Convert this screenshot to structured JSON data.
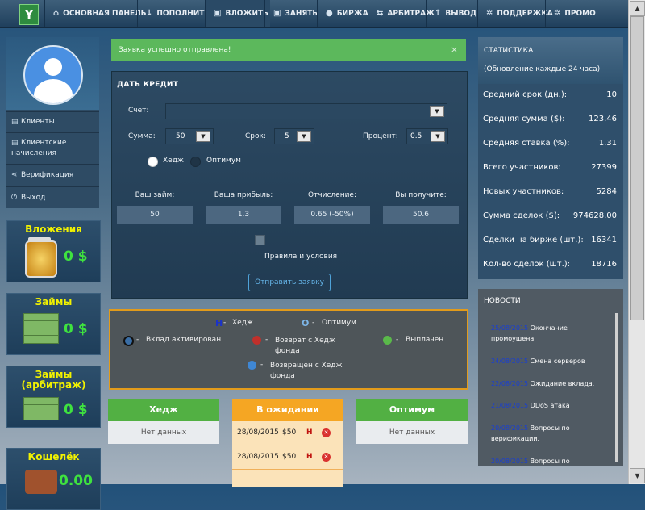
{
  "logo": "Y",
  "nav": [
    {
      "icon": "home-icon",
      "glyph": "⌂",
      "label": "ОСНОВНАЯ ПАНЕЛЬ"
    },
    {
      "icon": "download-icon",
      "glyph": "↓",
      "label": "ПОПОЛНИТЬ"
    },
    {
      "icon": "money-icon",
      "glyph": "▣",
      "label": "ВЛОЖИТЬ"
    },
    {
      "icon": "money-icon",
      "glyph": "▣",
      "label": "ЗАНЯТЬ"
    },
    {
      "icon": "globe-icon",
      "glyph": "●",
      "label": "БИРЖА"
    },
    {
      "icon": "exchange-icon",
      "glyph": "⇆",
      "label": "АРБИТРАЖ"
    },
    {
      "icon": "upload-icon",
      "glyph": "↑",
      "label": "ВЫВОД"
    },
    {
      "icon": "gears-icon",
      "glyph": "✲",
      "label": "ПОДДЕРЖКА"
    },
    {
      "icon": "gears-icon",
      "glyph": "✲",
      "label": "ПРОМО"
    }
  ],
  "user_menu": [
    {
      "icon": "chart-icon",
      "glyph": "▤",
      "label": "Клиенты"
    },
    {
      "icon": "chart-icon",
      "glyph": "▤",
      "label": "Клиентские начисления"
    },
    {
      "icon": "share-icon",
      "glyph": "⋖",
      "label": "Верификация"
    },
    {
      "icon": "power-icon",
      "glyph": "⏻",
      "label": "Выход"
    }
  ],
  "widgets": [
    {
      "title": "Вложения",
      "value": "0 $"
    },
    {
      "title": "Займы",
      "value": "0 $"
    },
    {
      "title": "Займы (арбитраж)",
      "value": "0 $"
    },
    {
      "title": "Кошелёк",
      "value": "0.00"
    }
  ],
  "alert": {
    "text": "Заявка успешно отправлена!",
    "close": "×"
  },
  "credit": {
    "title": "ДАТЬ КРЕДИТ",
    "account_label": "Счёт:",
    "account_value": "",
    "sum_label": "Сумма:",
    "sum_value": "50",
    "term_label": "Срок:",
    "term_value": "5",
    "percent_label": "Процент:",
    "percent_value": "0.5",
    "radio_hedge": "Хедж",
    "radio_optimum": "Оптимум",
    "your_loan_label": "Ваш займ:",
    "your_loan_value": "50",
    "profit_label": "Ваша прибыль:",
    "profit_value": "1.3",
    "deduction_label": "Отчисление:",
    "deduction_value": "0.65 (-50%)",
    "receive_label": "Вы получите:",
    "receive_value": "50.6",
    "terms_label": "Правила и условия",
    "submit_label": "Отправить заявку"
  },
  "legend": {
    "hedge_glyph": "H",
    "hedge": "Хедж",
    "optimum_glyph": "O",
    "optimum": "Оптимум",
    "active": "Вклад активирован",
    "returned_to": "Возврат с Хедж фонда",
    "paid": "Выплачен",
    "returned_from": "Возвращён с Хедж фонда",
    "dash": "-"
  },
  "columns": {
    "hedge": {
      "title": "Хедж",
      "body": "Нет данных"
    },
    "pending": {
      "title": "В ожидании",
      "rows": [
        {
          "date": "28/08/2015",
          "amount": "$50",
          "type": "H"
        },
        {
          "date": "28/08/2015",
          "amount": "$50",
          "type": "H"
        }
      ]
    },
    "optimum": {
      "title": "Оптимум",
      "body": "Нет данных"
    }
  },
  "stats": {
    "title": "СТАТИСТИКА",
    "subtitle": "(Обновление каждые 24 часа)",
    "rows": [
      {
        "label": "Средний срок (дн.):",
        "value": "10"
      },
      {
        "label": "Средняя сумма ($):",
        "value": "123.46"
      },
      {
        "label": "Средняя ставка (%):",
        "value": "1.31"
      },
      {
        "label": "Всего участников:",
        "value": "27399"
      },
      {
        "label": "Новых участников:",
        "value": "5284"
      },
      {
        "label": "Сумма сделок ($):",
        "value": "974628.00"
      },
      {
        "label": "Сделки на бирже (шт.):",
        "value": "16341"
      },
      {
        "label": "Кол-во сделок (шт.):",
        "value": "18716"
      }
    ]
  },
  "news": {
    "title": "НОВОСТИ",
    "items": [
      {
        "date": "25/08/2015",
        "text": "Окончание промоушена."
      },
      {
        "date": "24/08/2015",
        "text": "Смена серверов"
      },
      {
        "date": "22/08/2015",
        "text": "Ожидание вклада."
      },
      {
        "date": "21/08/2015",
        "text": "DDoS атака"
      },
      {
        "date": "20/08/2015",
        "text": "Вопросы по верификации."
      },
      {
        "date": "20/08/2015",
        "text": "Вопросы по"
      }
    ]
  },
  "colors": {
    "accent_green": "#5cb85c",
    "pending_orange": "#f5a623",
    "legend_border": "#e29b1b",
    "value_green": "#3fe23f",
    "widget_title": "#f2f200"
  }
}
